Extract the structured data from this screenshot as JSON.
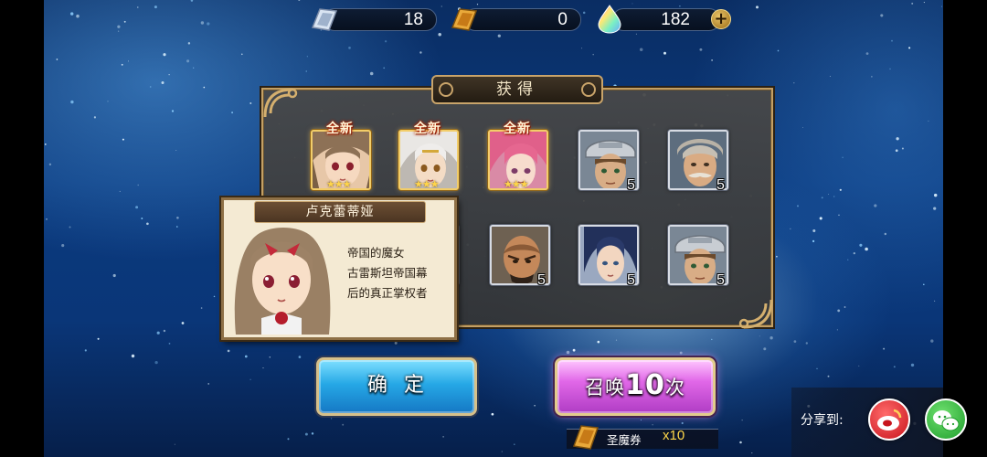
{
  "currencies": [
    {
      "name": "blue-ticket",
      "value": "18"
    },
    {
      "name": "gold-ticket",
      "value": "0"
    },
    {
      "name": "rainbow-crystal",
      "value": "182"
    }
  ],
  "plus_symbol": "+",
  "panel": {
    "title": "获得"
  },
  "new_badge": "全新",
  "rows": [
    [
      {
        "char": "lukreidia",
        "rarity": "★★★",
        "is_new": true
      },
      {
        "char": "silver-hair-girl",
        "rarity": "★★★",
        "is_new": true
      },
      {
        "char": "pink-hair-girl",
        "rarity": "★★★",
        "is_new": true
      },
      {
        "char": "helmet-soldier",
        "count": "5"
      },
      {
        "char": "mustache-officer",
        "count": "5"
      }
    ],
    [
      {
        "char": "hidden-by-popup",
        "count": ""
      },
      {
        "char": "bald-general",
        "count": "5"
      },
      {
        "char": "blue-hair-swordsman",
        "count": "5"
      },
      {
        "char": "helmet-soldier",
        "count": "5"
      }
    ]
  ],
  "info": {
    "name": "卢克蕾蒂娅",
    "desc_lines": [
      "帝国的魔女",
      "古雷斯坦帝国幕",
      "后的真正掌权者"
    ]
  },
  "buttons": {
    "confirm": "确定",
    "summon_prefix": "召唤",
    "summon_count": "10",
    "summon_suffix": "次"
  },
  "ticket": {
    "label": "圣魔券",
    "multiplier": "x10"
  },
  "share": {
    "label": "分享到:",
    "targets": [
      "weibo",
      "wechat"
    ]
  },
  "colors": {
    "gold_border": "#c4a064",
    "confirm_blue": "#26a8e6",
    "summon_pink": "#e168e8"
  }
}
